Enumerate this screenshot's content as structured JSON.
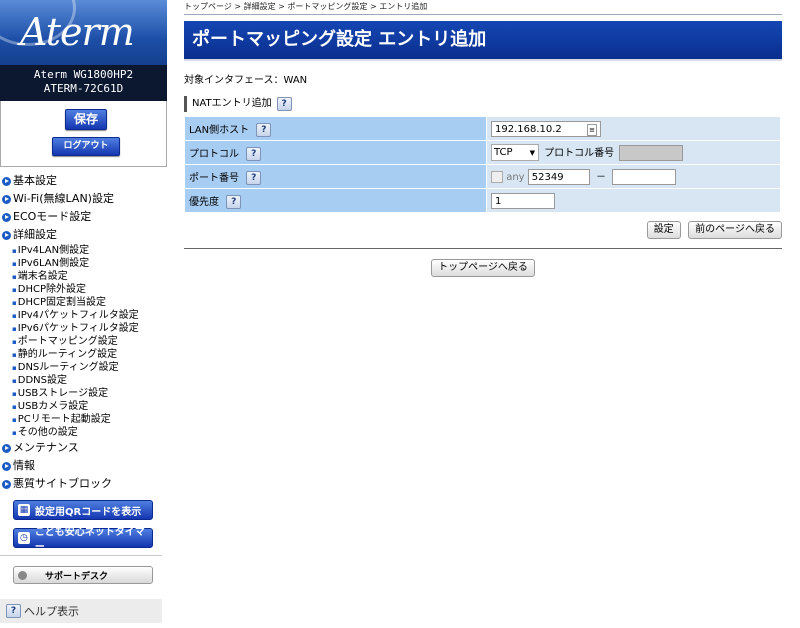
{
  "sidebar": {
    "logo_text": "Aterm",
    "model_name": "Aterm WG1800HP2",
    "device_id": "ATERM-72C61D",
    "save_label": "保存",
    "logout_label": "ログアウト",
    "nav": [
      {
        "label": "基本設定"
      },
      {
        "label": "Wi-Fi(無線LAN)設定"
      },
      {
        "label": "ECOモード設定"
      },
      {
        "label": "詳細設定"
      }
    ],
    "detail_items": [
      "IPv4LAN側設定",
      "IPv6LAN側設定",
      "端末名設定",
      "DHCP除外設定",
      "DHCP固定割当設定",
      "IPv4パケットフィルタ設定",
      "IPv6パケットフィルタ設定",
      "ポートマッピング設定",
      "静的ルーティング設定",
      "DNSルーティング設定",
      "DDNS設定",
      "USBストレージ設定",
      "USBカメラ設定",
      "PCリモート起動設定",
      "その他の設定"
    ],
    "nav_bottom": [
      {
        "label": "メンテナンス"
      },
      {
        "label": "情報"
      },
      {
        "label": "悪質サイトブロック"
      }
    ],
    "qr_button": "設定用QRコードを表示",
    "timer_button": "こども安心ネットタイマー",
    "support_button": "サポートデスク",
    "help_label": "ヘルプ表示"
  },
  "breadcrumb": "トップページ > 詳細設定 > ポートマッピング設定 > エントリ追加",
  "page_title": "ポートマッピング設定 エントリ追加",
  "interface_label": "対象インタフェース：WAN",
  "section_title": "NATエントリ追加",
  "help_glyph": "?",
  "form": {
    "lan_host_label": "LAN側ホスト",
    "lan_host_value": "192.168.10.2",
    "protocol_label": "プロトコル",
    "protocol_value": "TCP",
    "protocol_number_label": "プロトコル番号",
    "port_label": "ポート番号",
    "any_label": "any",
    "port_start": "52349",
    "port_sep": "－",
    "port_end": "",
    "priority_label": "優先度",
    "priority_value": "1"
  },
  "buttons": {
    "set": "設定",
    "back": "前のページへ戻る",
    "top": "トップページへ戻る"
  },
  "colors": {
    "title_bg": "#1546b4",
    "label_cell": "#a8cdf3",
    "value_cell": "#d8e6f4",
    "nav_bullet": "#1d5bc4"
  }
}
